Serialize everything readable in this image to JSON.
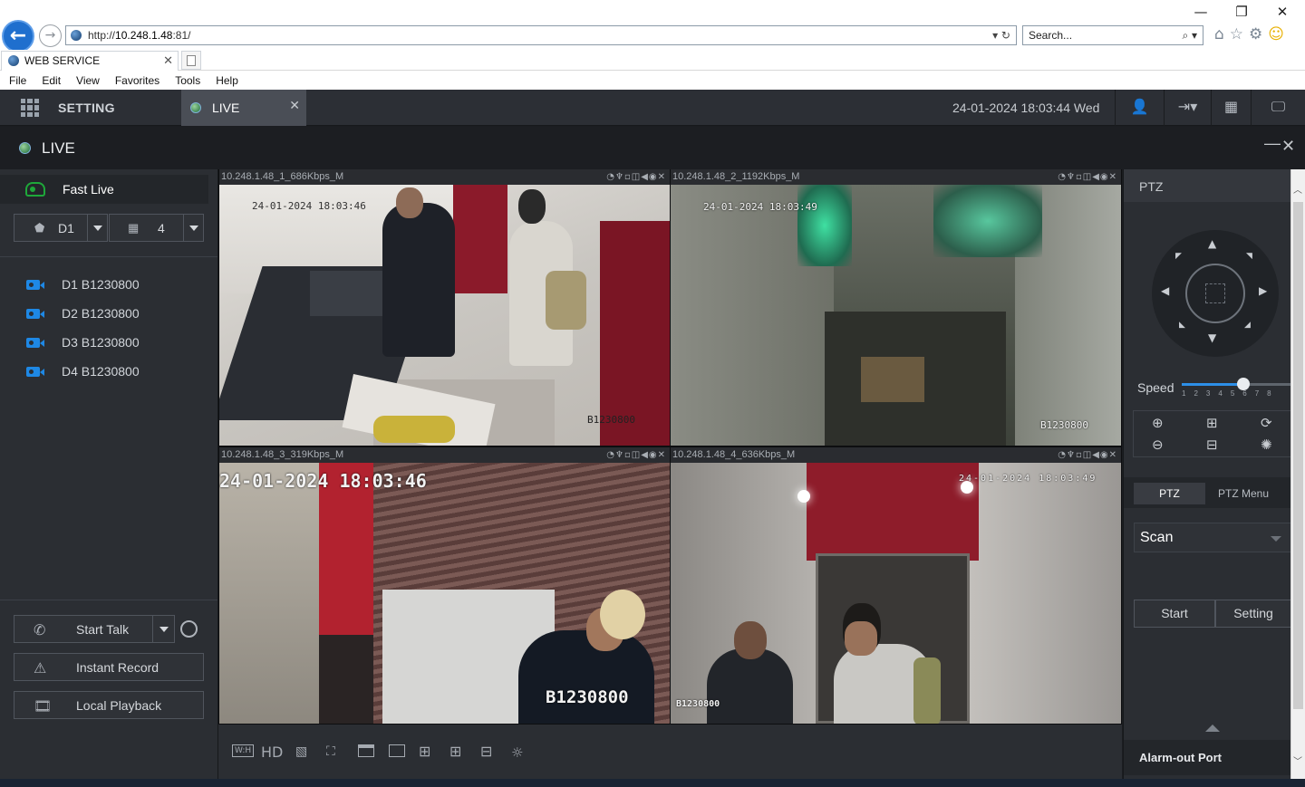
{
  "browser": {
    "window_controls": [
      "—",
      "❐",
      "✕"
    ],
    "url_prefix": "http://",
    "url_host": "10.248.1.48",
    "url_rest": ":81/",
    "search_placeholder": "Search...",
    "tab_title": "WEB SERVICE",
    "menu": [
      "File",
      "Edit",
      "View",
      "Favorites",
      "Tools",
      "Help"
    ]
  },
  "app_header": {
    "setting_label": "SETTING",
    "live_tab_label": "LIVE",
    "datetime": "24-01-2024 18:03:44 Wed"
  },
  "live_bar": {
    "title": "LIVE"
  },
  "left_panel": {
    "fast_live_label": "Fast Live",
    "device_select": "D1",
    "layout_select": "4",
    "channels": [
      "D1 B1230800",
      "D2 B1230800",
      "D3 B1230800",
      "D4 B1230800"
    ],
    "start_talk_label": "Start Talk",
    "instant_record_label": "Instant Record",
    "local_playback_label": "Local Playback"
  },
  "video_tiles": [
    {
      "header": "10.248.1.48_1_686Kbps_M",
      "osd_time": "24-01-2024 18:03:46",
      "osd_id": "B1230800"
    },
    {
      "header": "10.248.1.48_2_1192Kbps_M",
      "osd_time": "24-01-2024 18:03:49",
      "osd_id": "B1230800"
    },
    {
      "header": "10.248.1.48_3_319Kbps_M",
      "osd_time": "24-01-2024 18:03:46",
      "osd_id": "B1230800"
    },
    {
      "header": "10.248.1.48_4_636Kbps_M",
      "osd_time": "24-01-2024 18:03:49",
      "osd_id": "B1230800"
    }
  ],
  "tile_controls": "◔♆▫◫◀◉✕",
  "video_toolbar": {
    "hd_label": "HD",
    "wh_label": "W:H"
  },
  "ptz_panel": {
    "title": "PTZ",
    "speed_label": "Speed",
    "speed_ticks": [
      "1",
      "2",
      "3",
      "4",
      "5",
      "6",
      "7",
      "8"
    ],
    "speed_value": 5,
    "speed_max": 8,
    "tab_ptz": "PTZ",
    "tab_ptz_menu": "PTZ Menu",
    "mode_select": "Scan",
    "start_label": "Start",
    "setting_label": "Setting",
    "alarm_out_label": "Alarm-out Port"
  },
  "colors": {
    "header_bg": "#2c2f35",
    "panel_bg": "#2b2e33",
    "active_tile_border": "#3bd13b",
    "fast_live_icon": "#1ea83a",
    "camera_icon": "#1e88e5",
    "speed_fill": "#2d8fe8"
  }
}
